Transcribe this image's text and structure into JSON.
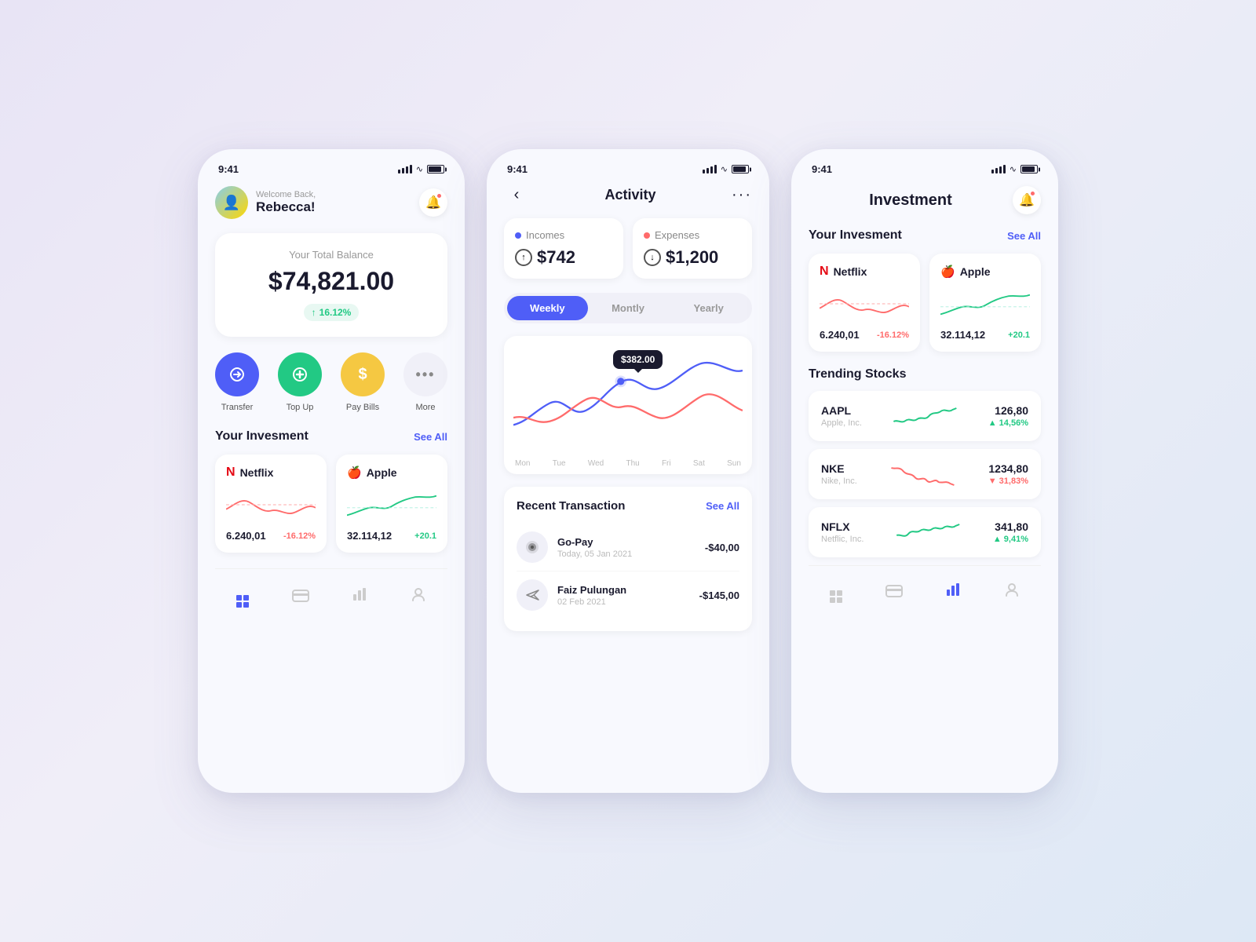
{
  "phone1": {
    "statusBar": {
      "time": "9:41"
    },
    "welcome": "Welcome Back,",
    "userName": "Rebecca!",
    "balance": {
      "label": "Your Total Balance",
      "amount": "$74,821.00",
      "change": "16.12%"
    },
    "actions": [
      {
        "id": "transfer",
        "label": "Transfer",
        "icon": "⟳",
        "colorClass": "action-blue"
      },
      {
        "id": "topup",
        "label": "Top Up",
        "icon": "+",
        "colorClass": "action-green"
      },
      {
        "id": "paybills",
        "label": "Pay Bills",
        "icon": "$",
        "colorClass": "action-yellow"
      },
      {
        "id": "more",
        "label": "More",
        "icon": "•••",
        "colorClass": "action-dots"
      }
    ],
    "investmentSection": {
      "title": "Your Invesment",
      "seeAll": "See All"
    },
    "stocks": [
      {
        "name": "Netflix",
        "icon": "N",
        "value": "6.240,01",
        "change": "-16.12%",
        "changeType": "neg"
      },
      {
        "name": "Apple",
        "icon": "🍎",
        "value": "32.114,12",
        "change": "+20.1",
        "changeType": "pos"
      }
    ],
    "nav": [
      "home",
      "card",
      "chart",
      "user"
    ]
  },
  "phone2": {
    "statusBar": {
      "time": "9:41"
    },
    "title": "Activity",
    "stats": [
      {
        "type": "income",
        "legendLabel": "Incomes",
        "value": "$742",
        "dotClass": "legend-blue"
      },
      {
        "type": "expense",
        "legendLabel": "Expenses",
        "value": "$1,200",
        "dotClass": "legend-red"
      }
    ],
    "tabs": [
      "Weekly",
      "Montly",
      "Yearly"
    ],
    "activeTab": "Weekly",
    "tooltipValue": "$382.00",
    "chartLabels": [
      "Mon",
      "Tue",
      "Wed",
      "Thu",
      "Fri",
      "Sat",
      "Sun"
    ],
    "recentTransaction": {
      "title": "Recent Transaction",
      "seeAll": "See All",
      "items": [
        {
          "name": "Go-Pay",
          "date": "Today, 05 Jan 2021",
          "amount": "-$40,00",
          "icon": "●"
        },
        {
          "name": "Faiz Pulungan",
          "date": "02 Feb 2021",
          "amount": "-$145,00",
          "icon": "➤"
        }
      ]
    }
  },
  "phone3": {
    "statusBar": {
      "time": "9:41"
    },
    "title": "Investment",
    "investmentSection": {
      "title": "Your Invesment",
      "seeAll": "See All"
    },
    "stocks": [
      {
        "name": "Netflix",
        "icon": "N",
        "value": "6.240,01",
        "change": "-16.12%",
        "changeType": "neg"
      },
      {
        "name": "Apple",
        "icon": "🍎",
        "value": "32.114,12",
        "change": "+20.1",
        "changeType": "pos"
      }
    ],
    "trending": {
      "title": "Trending Stocks",
      "items": [
        {
          "ticker": "AAPL",
          "company": "Apple, Inc.",
          "price": "126,80",
          "change": "▲ 14,56%",
          "type": "up"
        },
        {
          "ticker": "NKE",
          "company": "Nike, Inc.",
          "price": "1234,80",
          "change": "▼ 31,83%",
          "type": "down"
        },
        {
          "ticker": "NFLX",
          "company": "Netflic, Inc.",
          "price": "341,80",
          "change": "▲ 9,41%",
          "type": "up"
        }
      ]
    }
  }
}
